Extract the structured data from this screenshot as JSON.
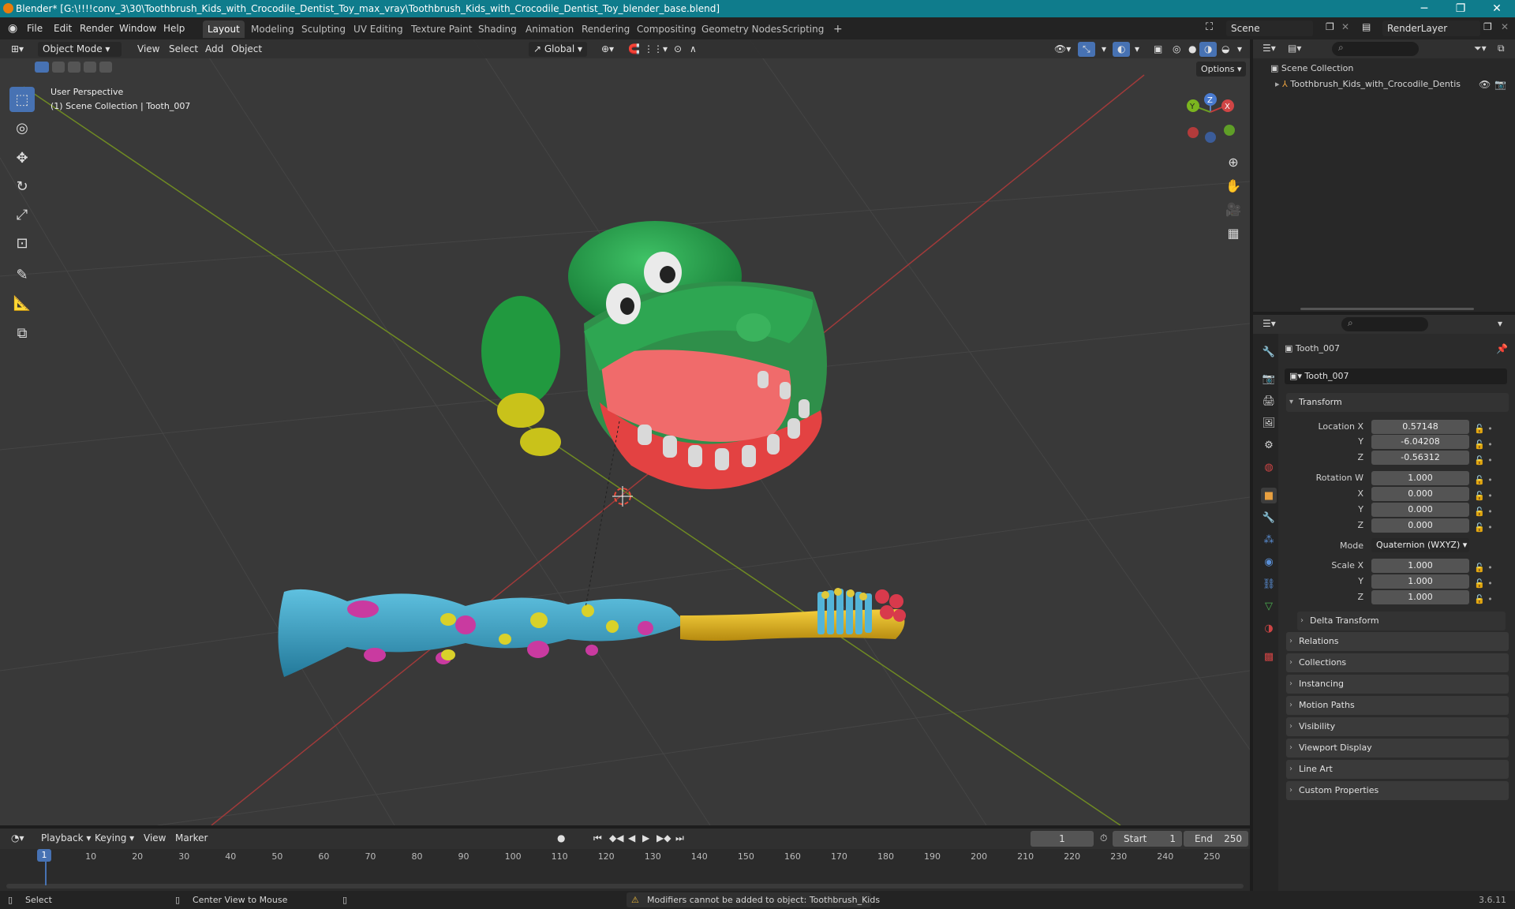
{
  "titlebar": {
    "title": "Blender* [G:\\!!!!conv_3\\30\\Toothbrush_Kids_with_Crocodile_Dentist_Toy_max_vray\\Toothbrush_Kids_with_Crocodile_Dentist_Toy_blender_base.blend]"
  },
  "menus": [
    "File",
    "Edit",
    "Render",
    "Window",
    "Help"
  ],
  "workspaces": [
    "Layout",
    "Modeling",
    "Sculpting",
    "UV Editing",
    "Texture Paint",
    "Shading",
    "Animation",
    "Rendering",
    "Compositing",
    "Geometry Nodes",
    "Scripting"
  ],
  "scene": {
    "name": "Scene",
    "render_layer": "RenderLayer"
  },
  "viewport_header": {
    "mode": "Object Mode",
    "menus": [
      "View",
      "Select",
      "Add",
      "Object"
    ],
    "orientation": "Global",
    "options": "Options"
  },
  "viewport": {
    "perspective": "User Perspective",
    "context": "(1) Scene Collection | Tooth_007"
  },
  "gizmo": {
    "x": "X",
    "y": "Y",
    "z": "Z"
  },
  "outliner": {
    "root": "Scene Collection",
    "item": "Toothbrush_Kids_with_Crocodile_Dentis"
  },
  "properties": {
    "object_name": "Tooth_007",
    "datablock": "Tooth_007",
    "transform_label": "Transform",
    "location_label": "Location X",
    "loc_x": "0.57148",
    "loc_y": "-6.04208",
    "loc_z": "-0.56312",
    "rotation_label": "Rotation W",
    "rot_w": "1.000",
    "rot_x": "0.000",
    "rot_y": "0.000",
    "rot_z": "0.000",
    "mode_label": "Mode",
    "mode_value": "Quaternion (WXYZ)",
    "scale_label": "Scale X",
    "scale_x": "1.000",
    "scale_y": "1.000",
    "scale_z": "1.000",
    "axis_y": "Y",
    "axis_z": "Z",
    "axis_x": "X",
    "delta": "Delta Transform",
    "sections": [
      "Relations",
      "Collections",
      "Instancing",
      "Motion Paths",
      "Visibility",
      "Viewport Display",
      "Line Art",
      "Custom Properties"
    ]
  },
  "timeline": {
    "menus": [
      "Playback",
      "Keying",
      "View",
      "Marker"
    ],
    "current_frame": "1",
    "start_label": "Start",
    "start": "1",
    "end_label": "End",
    "end": "250",
    "ticks": [
      "10",
      "20",
      "30",
      "40",
      "50",
      "60",
      "70",
      "80",
      "90",
      "100",
      "110",
      "120",
      "130",
      "140",
      "150",
      "160",
      "170",
      "180",
      "190",
      "200",
      "210",
      "220",
      "230",
      "240",
      "250"
    ],
    "playhead": "1"
  },
  "status": {
    "select": "Select",
    "center": "Center View to Mouse",
    "warning": "Modifiers cannot be added to object: Toothbrush_Kids",
    "version": "3.6.11"
  }
}
